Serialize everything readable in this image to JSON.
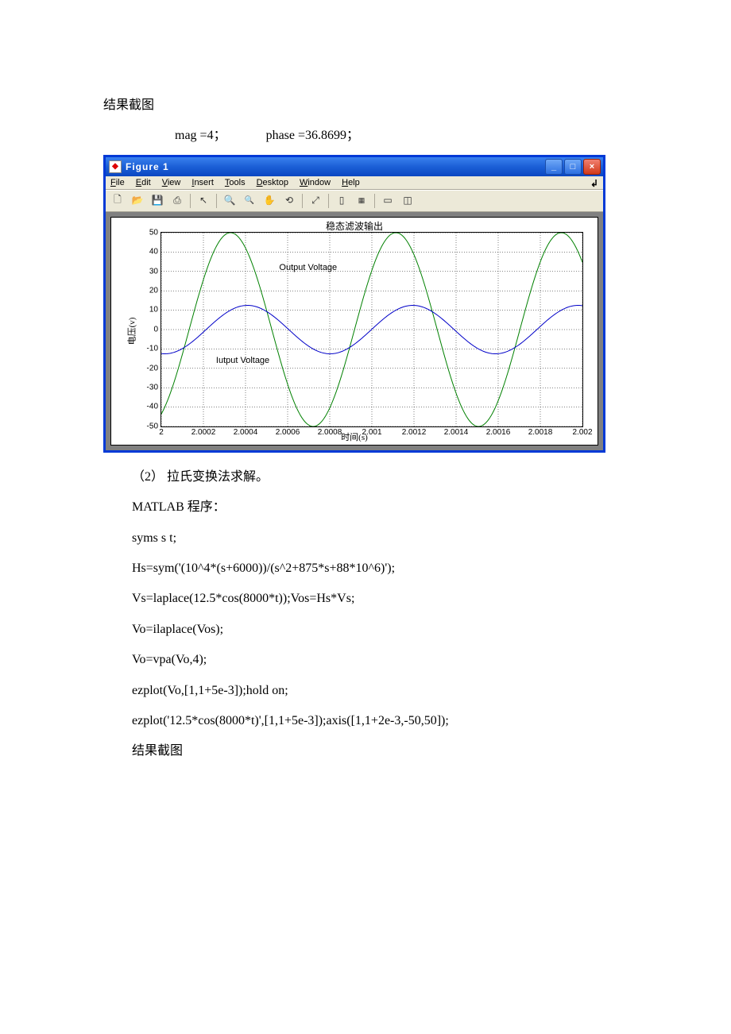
{
  "text": {
    "heading1": "结果截图",
    "values_line_mag": "mag =4；",
    "values_line_phase": "phase =36.8699；",
    "section2": "（2） 拉氏变换法求解。",
    "matlab_label": "MATLAB 程序：",
    "code1": "syms s t;",
    "code2": "Hs=sym('(10^4*(s+6000))/(s^2+875*s+88*10^6)');",
    "code3": "Vs=laplace(12.5*cos(8000*t));Vos=Hs*Vs;",
    "code4": "Vo=ilaplace(Vos);",
    "code5": "Vo=vpa(Vo,4);",
    "code6": "ezplot(Vo,[1,1+5e-3]);hold on;",
    "code7": "ezplot('12.5*cos(8000*t)',[1,1+5e-3]);axis([1,1+2e-3,-50,50]);",
    "heading2": "结果截图"
  },
  "window": {
    "title": "Figure 1",
    "menus": {
      "file": "File",
      "edit": "Edit",
      "view": "View",
      "insert": "Insert",
      "tools": "Tools",
      "desktop": "Desktop",
      "window": "Window",
      "help": "Help"
    },
    "toolbar_icons": [
      "new",
      "open",
      "save",
      "print",
      "arrow",
      "zoom-in",
      "zoom-out",
      "pan",
      "rotate",
      "datacursor",
      "colorbar",
      "legend",
      "hide",
      "dock"
    ]
  },
  "chart_data": {
    "type": "line",
    "title": "稳态滤波输出",
    "xlabel": "时间(s)",
    "ylabel": "电压(v)",
    "xlim": [
      2,
      2.002
    ],
    "ylim": [
      -50,
      50
    ],
    "xticks": [
      "2",
      "2.0002",
      "2.0004",
      "2.0006",
      "2.0008",
      "2.001",
      "2.0012",
      "2.0014",
      "2.0016",
      "2.0018",
      "2.002"
    ],
    "yticks": [
      -50,
      -40,
      -30,
      -20,
      -10,
      0,
      10,
      20,
      30,
      40,
      50
    ],
    "annotations": [
      {
        "text": "Output Voltage",
        "x_frac": 0.28,
        "y_value": 32
      },
      {
        "text": "Iutput Voltage",
        "x_frac": 0.13,
        "y_value": -16
      }
    ],
    "series": [
      {
        "name": "Output Voltage",
        "color": "#008000",
        "formula": "50*cos(8000*t + 0.6435)",
        "x_start": 2.0,
        "x_end": 2.002,
        "amplitude": 50,
        "omega": 8000,
        "phase_rad": 0.6435
      },
      {
        "name": "Input Voltage",
        "color": "#0000c8",
        "formula": "12.5*cos(8000*t)",
        "x_start": 2.0,
        "x_end": 2.002,
        "amplitude": 12.5,
        "omega": 8000,
        "phase_rad": 0
      }
    ]
  }
}
